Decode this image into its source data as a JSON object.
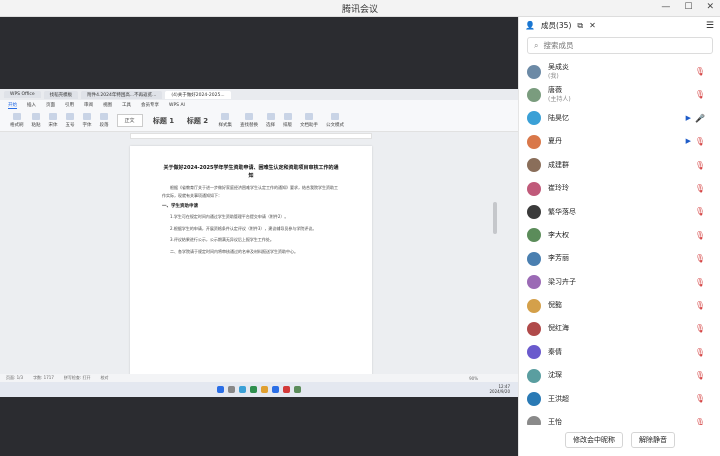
{
  "app": {
    "title": "腾讯会议"
  },
  "panel": {
    "title": "成员(35)",
    "search_placeholder": "搜索成员",
    "members": [
      {
        "name": "吴成炎",
        "role": "(我)",
        "color": "#6c8aa6",
        "mic": "muted"
      },
      {
        "name": "唐薇",
        "role": "(主持人)",
        "color": "#7a9c7e",
        "mic": "muted"
      },
      {
        "name": "陆昊忆",
        "role": "",
        "color": "#3aa0d6",
        "mic": "on",
        "cam": true
      },
      {
        "name": "夏丹",
        "role": "",
        "color": "#d9784a",
        "mic": "muted",
        "cam": true
      },
      {
        "name": "成建群",
        "role": "",
        "color": "#8a6e5a",
        "mic": "muted"
      },
      {
        "name": "崔玲玲",
        "role": "",
        "color": "#c05a7a",
        "mic": "muted"
      },
      {
        "name": "繁华落尽",
        "role": "",
        "color": "#3b3b3b",
        "mic": "muted"
      },
      {
        "name": "李大权",
        "role": "",
        "color": "#5b8c5a",
        "mic": "muted"
      },
      {
        "name": "李芳丽",
        "role": "",
        "color": "#4a7fb0",
        "mic": "muted"
      },
      {
        "name": "梁习卉子",
        "role": "",
        "color": "#9b6ab5",
        "mic": "muted"
      },
      {
        "name": "倪懿",
        "role": "",
        "color": "#d4a04a",
        "mic": "muted"
      },
      {
        "name": "倪红海",
        "role": "",
        "color": "#b04a4a",
        "mic": "muted"
      },
      {
        "name": "秦倩",
        "role": "",
        "color": "#6a5acd",
        "mic": "muted"
      },
      {
        "name": "沈琛",
        "role": "",
        "color": "#5a9ea0",
        "mic": "muted"
      },
      {
        "name": "王洪超",
        "role": "",
        "color": "#2a7ab5",
        "mic": "muted"
      },
      {
        "name": "王怡",
        "role": "",
        "color": "#8a8a8a",
        "mic": "muted"
      }
    ],
    "footer": {
      "rename_label": "修改会中昵称",
      "unmute_label": "解除静音"
    }
  },
  "shared": {
    "tabs": [
      "WPS Office",
      "找稻壳模板",
      "附件4.2024年特困高...不再返贫...",
      "(4)关于做好2024-2025..."
    ],
    "menus": [
      "开始",
      "插入",
      "页面",
      "引用",
      "审阅",
      "视图",
      "工具",
      "会员专享",
      "WPS AI"
    ],
    "ribbon_buttons": [
      "格式刷",
      "粘贴",
      "宋体",
      "五号",
      "字体",
      "段落"
    ],
    "styles": [
      "正文",
      "标题 1",
      "标题 2"
    ],
    "ribbon_right": [
      "样式集",
      "查找替换",
      "选择",
      "排版",
      "文档助手",
      "公文模式"
    ],
    "doc_title": "关于做好2024-2025学年学生资助申请、困难生认定和资助项目审核工作的通知",
    "paragraphs": [
      "根据《省教育厅关于进一步做好家庭经济困难学生认定工作的通知》要求，结合我院学生资助工作实际，现就有关事项通知如下：",
      "一、学生资助申请",
      "1.学生可在规定时间内通过学生资助管理平台提交申请（附件2）。",
      "2.根据学生的申请，开展资格条件认定评议（附件3），建议辅导员参与学院评议。",
      "3.评议结果进行公示，公示期满无异议后上报学生工作处。",
      "二、各学院请于规定时间内将审核通过的名单及材料报送学生资助中心。"
    ],
    "status": [
      "页面: 1/3",
      "字数: 1717",
      "拼写检查: 打开",
      "校对"
    ],
    "zoom": "90%",
    "clock_time": "12:47",
    "clock_date": "2024/9/20"
  }
}
